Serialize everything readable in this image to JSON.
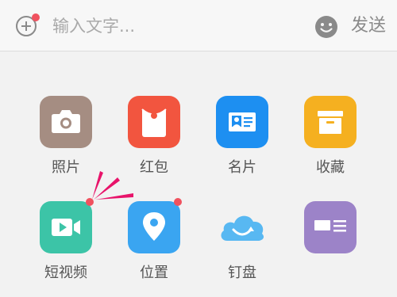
{
  "input_bar": {
    "placeholder": "输入文字...",
    "send_label": "发送",
    "plus_icon": "plus-circle-icon",
    "emoji_icon": "emoji-smile-icon"
  },
  "panel": {
    "items": [
      {
        "label": "照片",
        "icon": "camera-icon",
        "color": "#a58d82",
        "badge": false
      },
      {
        "label": "红包",
        "icon": "red-envelope-icon",
        "color": "#f2553f",
        "badge": false
      },
      {
        "label": "名片",
        "icon": "business-card-icon",
        "color": "#1d8ff1",
        "badge": false
      },
      {
        "label": "收藏",
        "icon": "archive-box-icon",
        "color": "#f5b020",
        "badge": false
      },
      {
        "label": "短视频",
        "icon": "video-camera-icon",
        "color": "#3cc4a7",
        "badge": true
      },
      {
        "label": "位置",
        "icon": "location-pin-icon",
        "color": "#3aa5f1",
        "badge": true
      },
      {
        "label": "钉盘",
        "icon": "cloud-sync-icon",
        "color": "#58b8f2",
        "badge": false
      },
      {
        "label": "",
        "icon": "calendar-card-icon",
        "color": "#9c83c8",
        "badge": false
      }
    ]
  },
  "colors": {
    "badge": "#f0525f",
    "text": "#555555",
    "muted": "#a9a9a9"
  }
}
